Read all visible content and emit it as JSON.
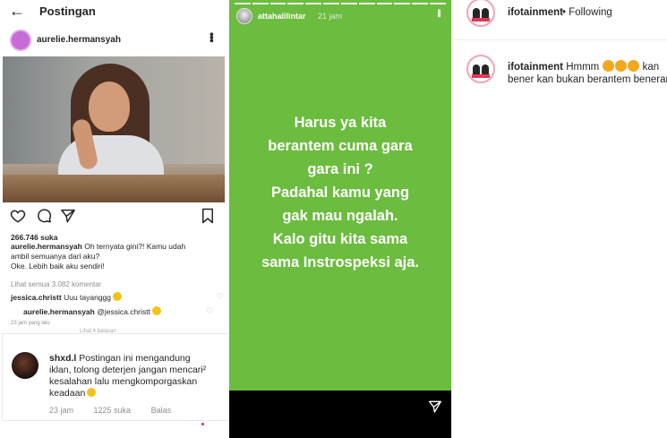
{
  "left": {
    "title": "Postingan",
    "username": "aurelie.hermansyah",
    "likes": "266.746 suka",
    "caption_user": "aurelie.hermansyah",
    "caption_line1": "Oh ternyata gini?! Kamu udah",
    "caption_line2": "ambil semuanya dari aku?",
    "caption_line3": "Oke. Lebih baik aku sendiri!",
    "view_comments": "Lihat semua 3.082 komentar",
    "comment1_user": "jessica.christt",
    "comment1_text": "Uuu tayanggg",
    "comment2_user": "aurelie.hermansyah",
    "comment2_text": "@jessica.christt",
    "time_small": "23 jam yang lalu",
    "faded_text": "Lihat 4 balasan"
  },
  "popup": {
    "user": "shxd.l",
    "text1": "Postingan ini mengandung",
    "text2": "iklan, tolong deterjen jangan mencari²",
    "text3": "kesalahan lalu mengkomporgaskan",
    "text4": "keadaan",
    "time": "23 jam",
    "likes": "1225 suka",
    "reply": "Balas"
  },
  "story": {
    "username": "attahalilintar",
    "time": "21 jam",
    "lines": [
      "Harus ya kita",
      "berantem cuma gara",
      "gara ini ?",
      "Padahal kamu yang",
      "gak mau ngalah.",
      "Kalo gitu kita sama",
      "sama Instrospeksi aja."
    ]
  },
  "right": {
    "username": "ifotainment",
    "following": "• Following",
    "comment_user": "ifotainment",
    "comment_text": "Hmmm",
    "comment_tail": "kan",
    "comment_line2": "bener kan bukan berantem beneran"
  },
  "colors": {
    "story_bg": "#6cbc3f",
    "text_dark": "#262626",
    "muted": "#8e8e8e"
  }
}
